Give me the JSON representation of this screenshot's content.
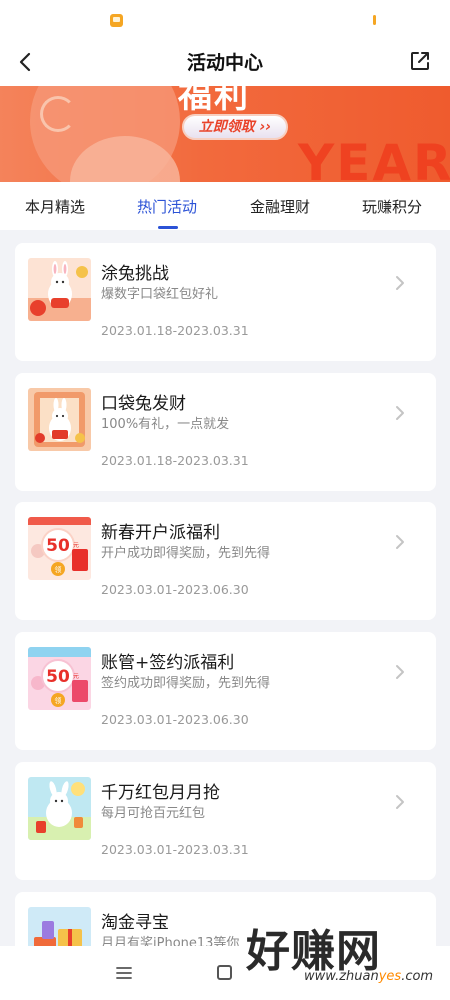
{
  "nav": {
    "title": "活动中心"
  },
  "banner": {
    "headline": "福利",
    "button_label": "立即领取 ››",
    "decor_text": "YEAR"
  },
  "tabs": [
    {
      "label": "本月精选",
      "active": false
    },
    {
      "label": "热门活动",
      "active": true
    },
    {
      "label": "金融理财",
      "active": false
    },
    {
      "label": "玩赚积分",
      "active": false
    }
  ],
  "activities": [
    {
      "title": "涂兔挑战",
      "subtitle": "爆数字口袋红包好礼",
      "date": "2023.01.18-2023.03.31",
      "icon": "rabbit-lantern-thumbnail"
    },
    {
      "title": "口袋兔发财",
      "subtitle": "100%有礼，一点就发",
      "date": "2023.01.18-2023.03.31",
      "icon": "rabbit-door-thumbnail"
    },
    {
      "title": "新春开户派福利",
      "subtitle": "开户成功即得奖励，先到先得",
      "date": "2023.03.01-2023.06.30",
      "icon": "red-envelope-50-thumbnail",
      "badge": "50",
      "badge_unit": "元",
      "badge_tag": "领"
    },
    {
      "title": "账管+签约派福利",
      "subtitle": "签约成功即得奖励，先到先得",
      "date": "2023.03.01-2023.06.30",
      "icon": "red-envelope-50-pink-thumbnail",
      "badge": "50",
      "badge_unit": "元",
      "badge_tag": "领"
    },
    {
      "title": "千万红包月月抢",
      "subtitle": "每月可抢百元红包",
      "date": "2023.03.01-2023.03.31",
      "icon": "rabbit-sky-thumbnail"
    },
    {
      "title": "淘金寻宝",
      "subtitle": "月月有奖iPhone13等你",
      "date": "",
      "icon": "gift-box-thumbnail"
    }
  ],
  "watermark": {
    "text": "好赚网",
    "url_pre": "www.zhuan",
    "url_hi": "yes",
    "url_post": ".com"
  },
  "colors": {
    "accent": "#2b52d6",
    "banner": "#f26a3d",
    "background": "#f2f3f7"
  }
}
